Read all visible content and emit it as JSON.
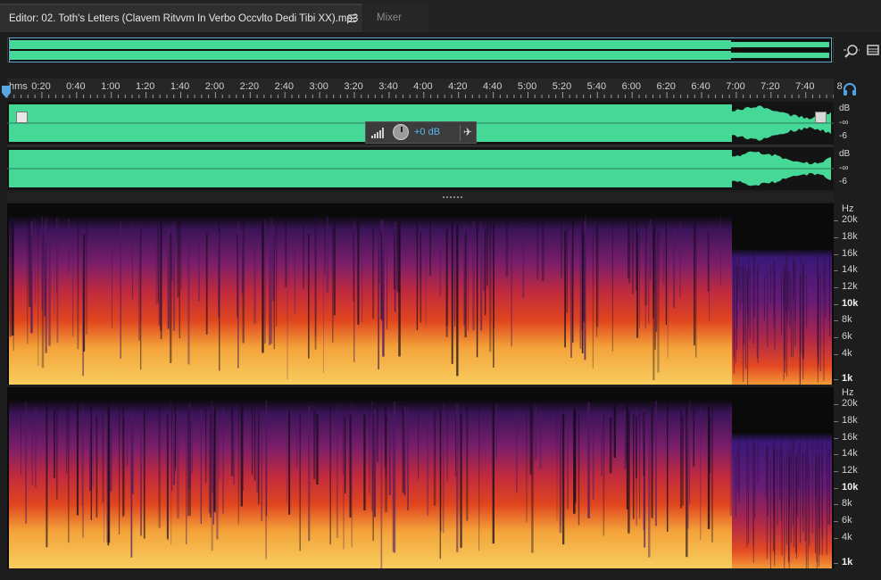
{
  "tabs": {
    "editor_label": "Editor: 02. Toth's Letters (Clavem Ritvvm In Verbo Occvlto Dedi Tibi XX).mp3",
    "editor_menu_glyph": "☰",
    "mixer_label": "Mixer"
  },
  "ruler": {
    "unit": "hms",
    "ticks": [
      "0:20",
      "0:40",
      "1:00",
      "1:20",
      "1:40",
      "2:00",
      "2:20",
      "2:40",
      "3:00",
      "3:20",
      "3:40",
      "4:00",
      "4:20",
      "4:40",
      "5:00",
      "5:20",
      "5:40",
      "6:00",
      "6:20",
      "6:40",
      "7:00",
      "7:20",
      "7:40",
      "8"
    ]
  },
  "tracks": [
    {
      "db_labels": [
        "dB",
        "-∞",
        "-6"
      ]
    },
    {
      "db_labels": [
        "dB",
        "-∞",
        "-6"
      ]
    }
  ],
  "hud": {
    "volume_value": "+0 dB",
    "pin_glyph": "✈"
  },
  "spectral": {
    "hz_labels": [
      "Hz",
      "20k",
      "18k",
      "16k",
      "14k",
      "12k",
      "10k",
      "8k",
      "6k",
      "4k",
      "1k"
    ],
    "bold_labels": [
      "10k",
      "1k"
    ]
  },
  "icons": {
    "zoom": "zoom-icon",
    "panel_menu": "panel-menu-icon",
    "headphone": "headphone-icon",
    "playhead": "playhead-marker",
    "meter": "meter-icon",
    "pin": "pin-icon"
  },
  "colors": {
    "waveform": "#46d897",
    "accent": "#58b6e8",
    "background": "#1d1d1d"
  }
}
